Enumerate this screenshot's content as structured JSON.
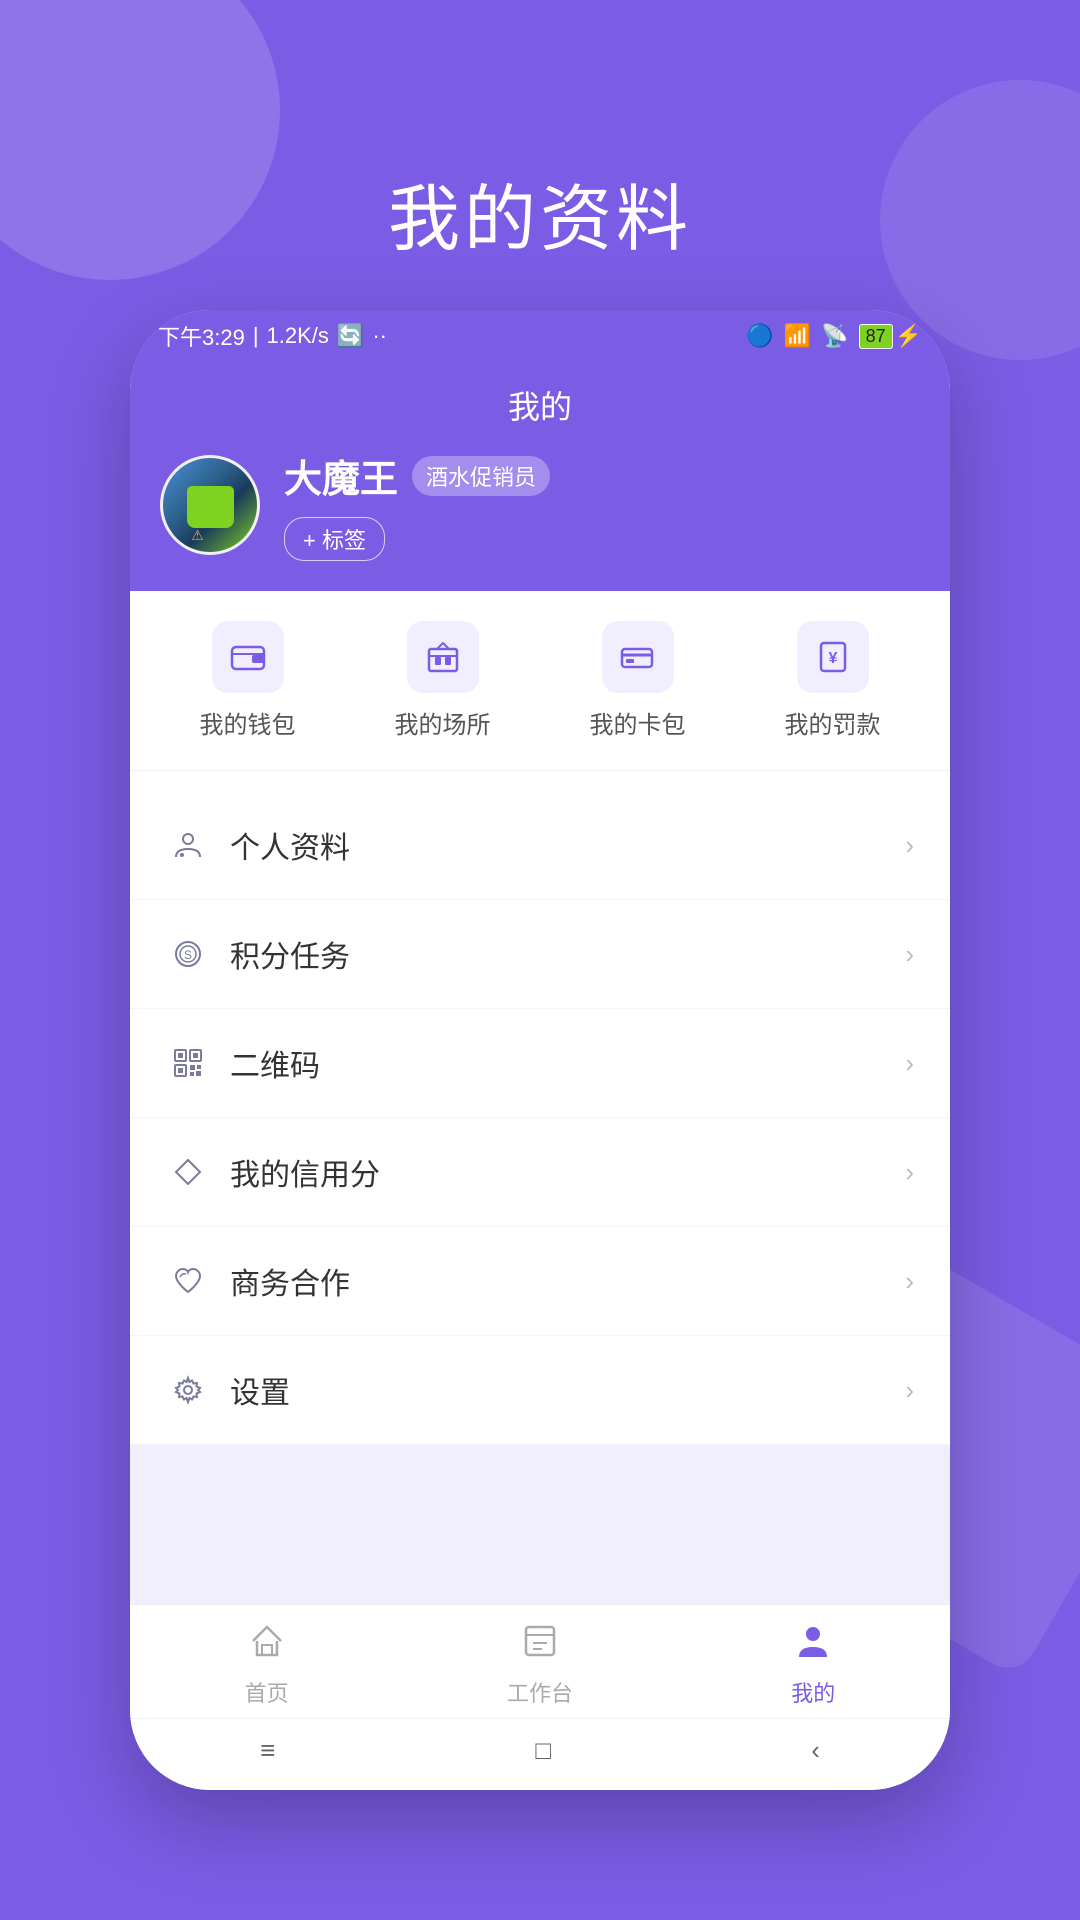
{
  "page": {
    "title": "我的资料",
    "bg_color": "#7b5ce5"
  },
  "status_bar": {
    "time": "下午3:29",
    "network_speed": "1.2K/s",
    "battery_level": "87"
  },
  "header": {
    "title": "我的"
  },
  "profile": {
    "username": "大魔王",
    "role_badge": "酒水促销员",
    "tag_button_label": "+ 标签"
  },
  "quick_access": [
    {
      "icon": "💼",
      "label": "我的钱包"
    },
    {
      "icon": "🏢",
      "label": "我的场所"
    },
    {
      "icon": "💳",
      "label": "我的卡包"
    },
    {
      "icon": "¥",
      "label": "我的罚款"
    }
  ],
  "menu_items": [
    {
      "icon": "👤",
      "label": "个人资料",
      "icon_type": "person"
    },
    {
      "icon": "🎯",
      "label": "积分任务",
      "icon_type": "coin"
    },
    {
      "icon": "⬛",
      "label": "二维码",
      "icon_type": "qr"
    },
    {
      "icon": "🔷",
      "label": "我的信用分",
      "icon_type": "diamond"
    },
    {
      "icon": "❤",
      "label": "商务合作",
      "icon_type": "heart"
    },
    {
      "icon": "⚙",
      "label": "设置",
      "icon_type": "gear"
    }
  ],
  "bottom_nav": [
    {
      "label": "首页",
      "icon": "🏠",
      "active": false
    },
    {
      "label": "工作台",
      "icon": "📋",
      "active": false
    },
    {
      "label": "我的",
      "icon": "👤",
      "active": true
    }
  ],
  "system_nav": [
    "≡",
    "□",
    "‹"
  ]
}
